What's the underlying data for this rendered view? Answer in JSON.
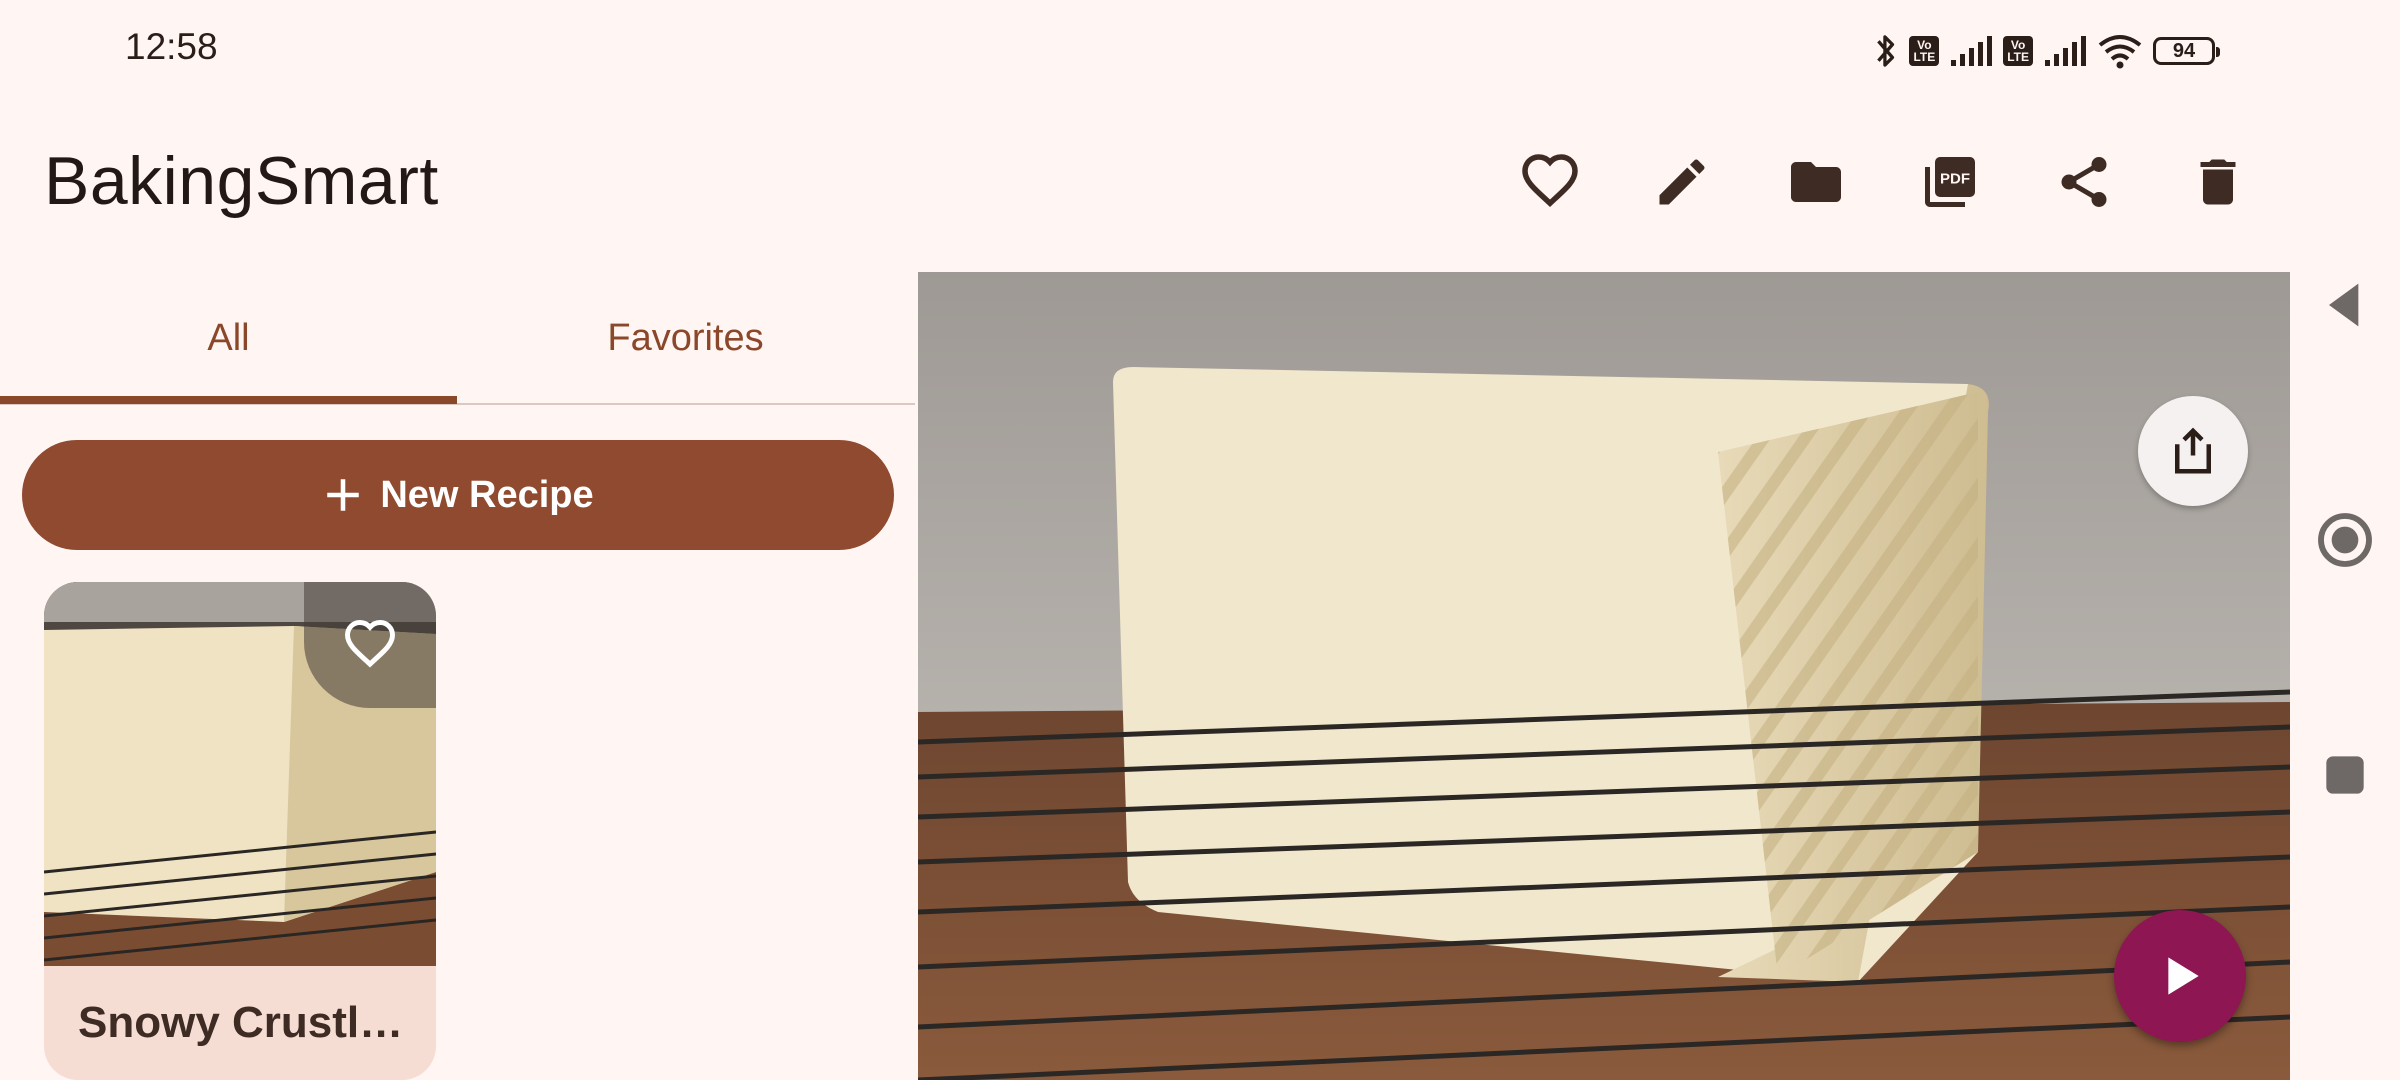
{
  "status_bar": {
    "time": "12:58",
    "icons": [
      "bluetooth-icon",
      "volte-icon",
      "signal-icon",
      "volte-icon",
      "signal-icon",
      "wifi-icon",
      "battery-icon"
    ],
    "volte_label_top": "Vo",
    "volte_label_bottom": "LTE",
    "battery_level": "94"
  },
  "app_bar": {
    "title": "BakingSmart",
    "actions": [
      "heart-outline-icon",
      "edit-icon",
      "folder-icon",
      "pdf-icon",
      "share-icon",
      "delete-icon"
    ]
  },
  "tabs": {
    "items": [
      {
        "label": "All",
        "selected": true
      },
      {
        "label": "Favorites",
        "selected": false
      }
    ]
  },
  "new_recipe": {
    "label": "New Recipe",
    "icon": "plus-icon"
  },
  "recipes": [
    {
      "title": "Snowy Crustl…",
      "favorite": false
    }
  ],
  "detail": {
    "image": "bread-loaf-on-cooling-rack",
    "share_icon": "share-image-icon",
    "play_icon": "play-icon"
  },
  "system_nav": [
    "back-icon",
    "home-icon",
    "recents-icon"
  ],
  "colors": {
    "background": "#fff5f3",
    "accent": "#8f4a2f",
    "play": "#8d1653",
    "card": "#f6ddd4"
  }
}
